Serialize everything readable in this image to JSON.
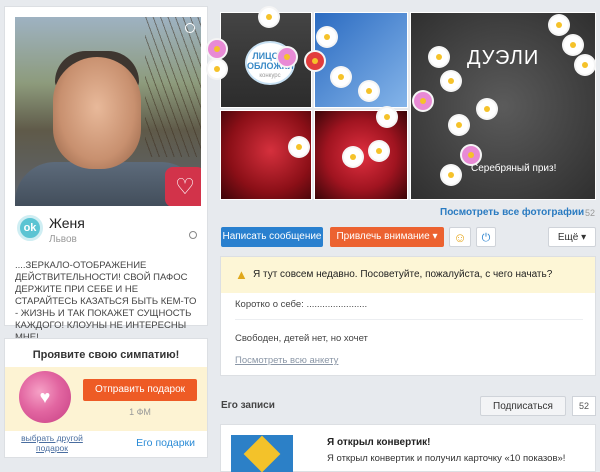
{
  "profile": {
    "name": "Женя",
    "city": "Львов",
    "status": "....ЗЕРКАЛО-ОТОБРАЖЕНИЕ ДЕЙСТВИТЕЛЬНОСТИ! СВОЙ ПАФОС ДЕРЖИТЕ ПРИ СЕБЕ И НЕ СТАРАЙТЕСЬ КАЗАТЬСЯ БЫТЬ КЕМ-ТО - ЖИЗНЬ И ТАК ПОКАЖЕТ СУЩНОСТЬ КАЖДОГО! КЛОУНЫ НЕ ИНТЕРЕСНЫ МНЕ!",
    "avatar_heart": "♡",
    "online_glyph": "ok"
  },
  "gift": {
    "title": "Проявите свою симпатию!",
    "send_label": "Отправить подарок",
    "price": "1 ФМ",
    "other_label": "выбрать другой подарок",
    "his_gifts_label": "Его подарки",
    "image_glyph": "♥"
  },
  "photos": {
    "contest_badge": "ЛИЦО С ОБЛОЖКИ",
    "contest_small": "конкурс",
    "duel_title": "ДУЭЛИ",
    "duel_prize": "Серебряный приз!",
    "view_all_label": "Посмотреть все фотографии",
    "count": "52"
  },
  "actions": {
    "write_message": "Написать сообщение",
    "attract_attention": "Привлечь внимание",
    "attract_caret": "▾",
    "smile_icon": "☺",
    "power_icon": "⏻",
    "more": "Ещё ▾"
  },
  "about": {
    "hint": "Я тут совсем недавно. Посоветуйте, пожалуйста, с чего начать?",
    "hint_icon": "▲",
    "short_about": "Коротко о себе: .......................",
    "relationship": "Свободен, детей нет, но хочет",
    "view_profile": "Посмотреть всю анкету"
  },
  "posts": {
    "title": "Его записи",
    "subscribe": "Подписаться",
    "subscriber_count": "52",
    "items": [
      {
        "title": "Я открыл конвертик!",
        "description": "Я открыл конвертик и получил карточку «10 показов»!"
      }
    ]
  },
  "colors": {
    "accent_blue": "#2980cf",
    "accent_orange": "#ec6230",
    "hint_bg": "#fdf6d6",
    "page_bg": "#e7eaee"
  }
}
